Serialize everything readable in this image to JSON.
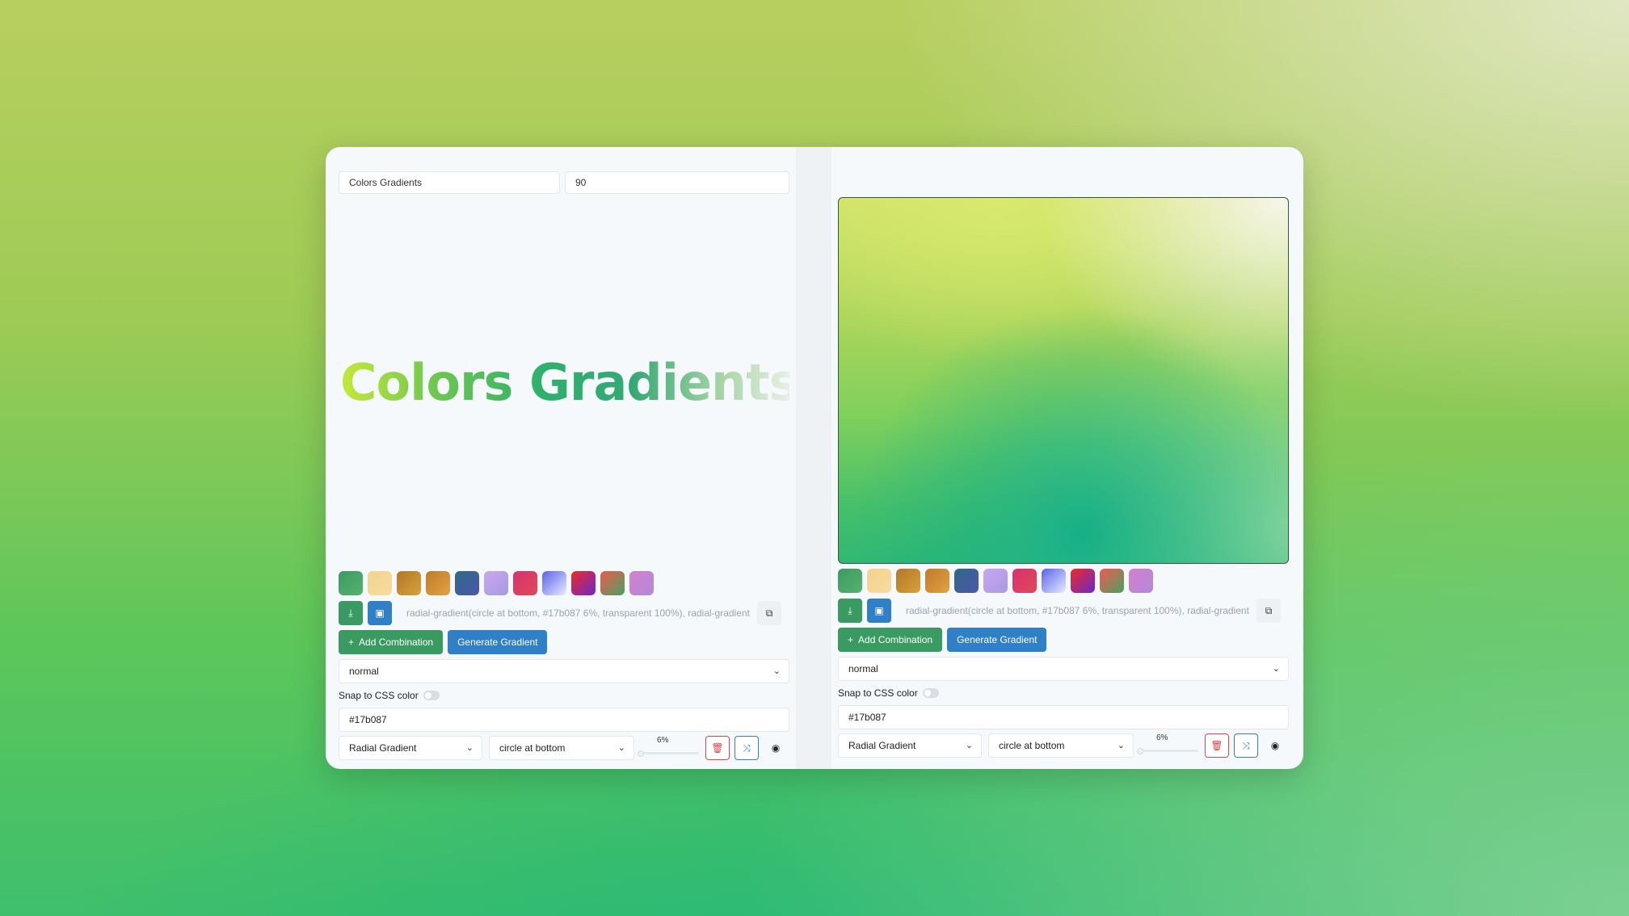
{
  "left": {
    "title_input": "Colors Gradients",
    "angle_input": "90",
    "big_title": "Colors Gradients"
  },
  "shared": {
    "swatches": [
      "linear-gradient(135deg,#3a9b62,#57b26f)",
      "linear-gradient(135deg,#f3d38d,#f7dca0)",
      "linear-gradient(135deg,#b3762a,#d8a238)",
      "linear-gradient(135deg,#c27a2a,#e0a242)",
      "linear-gradient(135deg,#2e6a8a,#4e56a8)",
      "linear-gradient(135deg,#c8a8f0,#a89ae0)",
      "linear-gradient(135deg,#d83070,#e04a58)",
      "linear-gradient(135deg,#5a62e8,#e6ecff)",
      "linear-gradient(135deg,#ef2a2a,#6a28c8)",
      "linear-gradient(135deg,#f05a50,#4aa060)",
      "linear-gradient(135deg,#d57fcf,#b08ad8)"
    ],
    "css_output": "radial-gradient(circle at bottom, #17b087 6%, transparent 100%), radial-gradient",
    "add_combination_label": "Add Combination",
    "generate_gradient_label": "Generate Gradient",
    "blend_mode": "normal",
    "snap_label": "Snap to CSS color",
    "color_value": "#17b087",
    "gradient_type": "Radial Gradient",
    "gradient_position": "circle at bottom",
    "stop_percent": "6%",
    "colors": {
      "primary_green": "#3a9b62",
      "primary_blue": "#2f80c7",
      "danger_red": "#d04848",
      "stop_color": "#17b087"
    }
  }
}
